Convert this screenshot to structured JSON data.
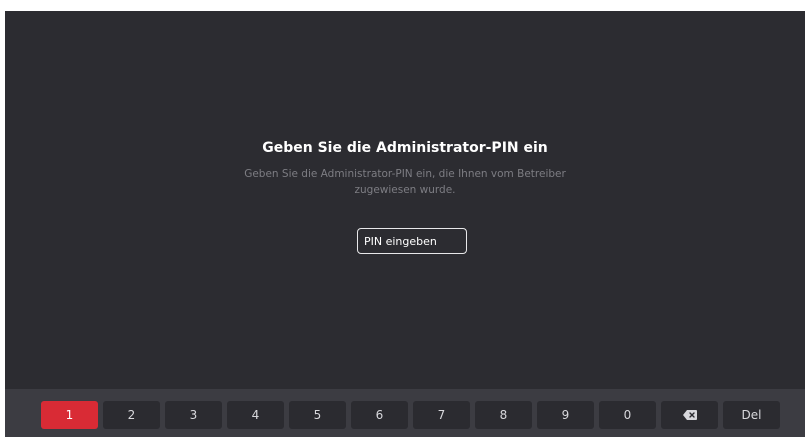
{
  "dialog": {
    "title": "Geben Sie die Administrator-PIN ein",
    "subtitle_line1": "Geben Sie die Administrator-PIN ein, die Ihnen vom Betreiber",
    "subtitle_line2": "zugewiesen wurde.",
    "pin_placeholder": "PIN eingeben"
  },
  "keypad": {
    "keys": [
      "1",
      "2",
      "3",
      "4",
      "5",
      "6",
      "7",
      "8",
      "9",
      "0"
    ],
    "backspace_icon": "backspace-icon",
    "delete_label": "Del",
    "active_key": "1"
  },
  "colors": {
    "background": "#2c2c31",
    "keypad_bar": "#3c3c42",
    "key": "#2b2b30",
    "accent": "#d92b35"
  }
}
